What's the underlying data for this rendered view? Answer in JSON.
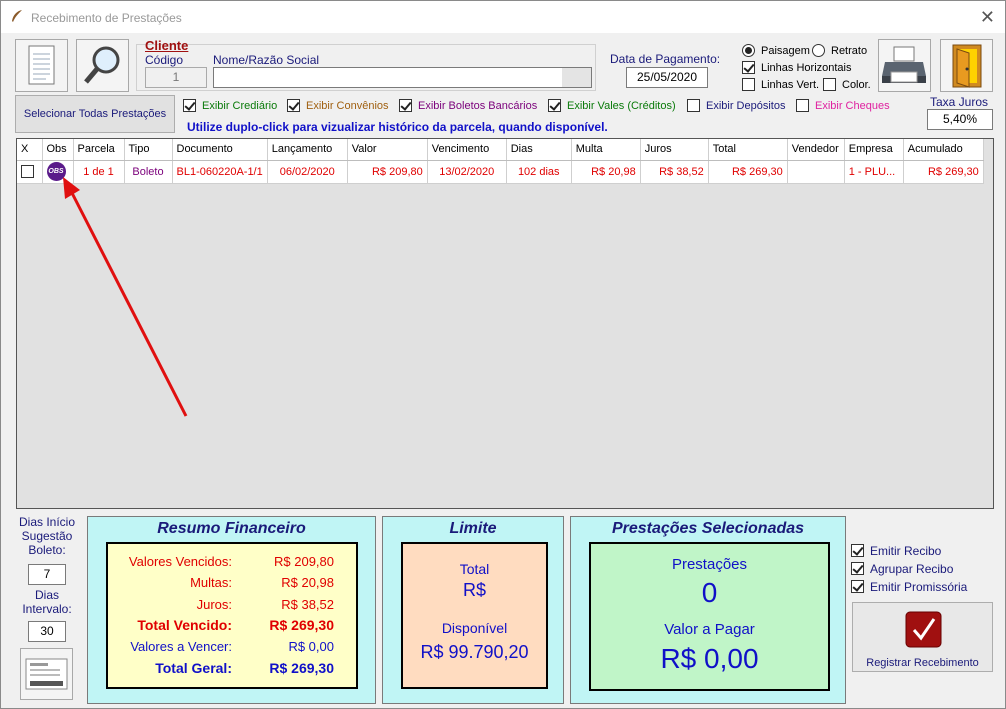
{
  "window": {
    "title": "Recebimento de Prestações",
    "close": "✕"
  },
  "client": {
    "header": "Cliente",
    "code_label": "Código",
    "code_value": "1",
    "name_label": "Nome/Razão Social",
    "name_value": ""
  },
  "payment": {
    "label": "Data de Pagamento:",
    "date": "25/05/2020"
  },
  "print_options": {
    "landscape": "Paisagem",
    "portrait": "Retrato",
    "horizontal_lines": "Linhas Horizontais",
    "vertical_lines": "Linhas Vert.",
    "color": "Color."
  },
  "interest": {
    "label": "Taxa Juros",
    "value": "5,40%"
  },
  "toolbar": {
    "select_all": "Selecionar Todas Prestações"
  },
  "filters": {
    "crediario": "Exibir Crediário",
    "convenios": "Exibir Convênios",
    "boletos": "Exibir Boletos Bancários",
    "vales": "Exibir Vales (Créditos)",
    "depositos": "Exibir Depósitos",
    "cheques": "Exibir Cheques"
  },
  "hint": "Utilize duplo-click para vizualizar histórico da parcela, quando disponível.",
  "table": {
    "headers": [
      "X",
      "Obs",
      "Parcela",
      "Tipo",
      "Documento",
      "Lançamento",
      "Valor",
      "Vencimento",
      "Dias",
      "Multa",
      "Juros",
      "Total",
      "Vendedor",
      "Empresa",
      "Acumulado"
    ],
    "rows": [
      {
        "obs": "OBS",
        "parcela": "1 de 1",
        "tipo": "Boleto",
        "documento": "BL1-060220A-1/1",
        "lancamento": "06/02/2020",
        "valor": "R$ 209,80",
        "vencimento": "13/02/2020",
        "dias": "102 dias",
        "multa": "R$ 20,98",
        "juros": "R$ 38,52",
        "total": "R$ 269,30",
        "vendedor": "",
        "empresa": "1 - PLU...",
        "acumulado": "R$ 269,30"
      }
    ]
  },
  "left_side": {
    "dias_inicio_label": "Dias Início Sugestão Boleto:",
    "dias_inicio_value": "7",
    "dias_intervalo_label": "Dias Intervalo:",
    "dias_intervalo_value": "30"
  },
  "resumo": {
    "title": "Resumo Financeiro",
    "vencidos_label": "Valores Vencidos:",
    "vencidos_value": "R$ 209,80",
    "multas_label": "Multas:",
    "multas_value": "R$ 20,98",
    "juros_label": "Juros:",
    "juros_value": "R$ 38,52",
    "total_vencido_label": "Total Vencido:",
    "total_vencido_value": "R$ 269,30",
    "a_vencer_label": "Valores a Vencer:",
    "a_vencer_value": "R$ 0,00",
    "total_geral_label": "Total Geral:",
    "total_geral_value": "R$ 269,30"
  },
  "limite": {
    "title": "Limite",
    "total_label": "Total",
    "total_value": "R$",
    "disponivel_label": "Disponível",
    "disponivel_value": "R$ 99.790,20"
  },
  "selecionadas": {
    "title": "Prestações Selecionadas",
    "count_label": "Prestações",
    "count_value": "0",
    "pagar_label": "Valor a Pagar",
    "pagar_value": "R$ 0,00"
  },
  "options": {
    "emitir_recibo": "Emitir Recibo",
    "agrupar_recibo": "Agrupar Recibo",
    "emitir_promissoria": "Emitir Promissória",
    "registrar": "Registrar Recebimento"
  },
  "colors": {
    "panel_bg": "#c0f5f5",
    "arrow": "#e01010"
  }
}
